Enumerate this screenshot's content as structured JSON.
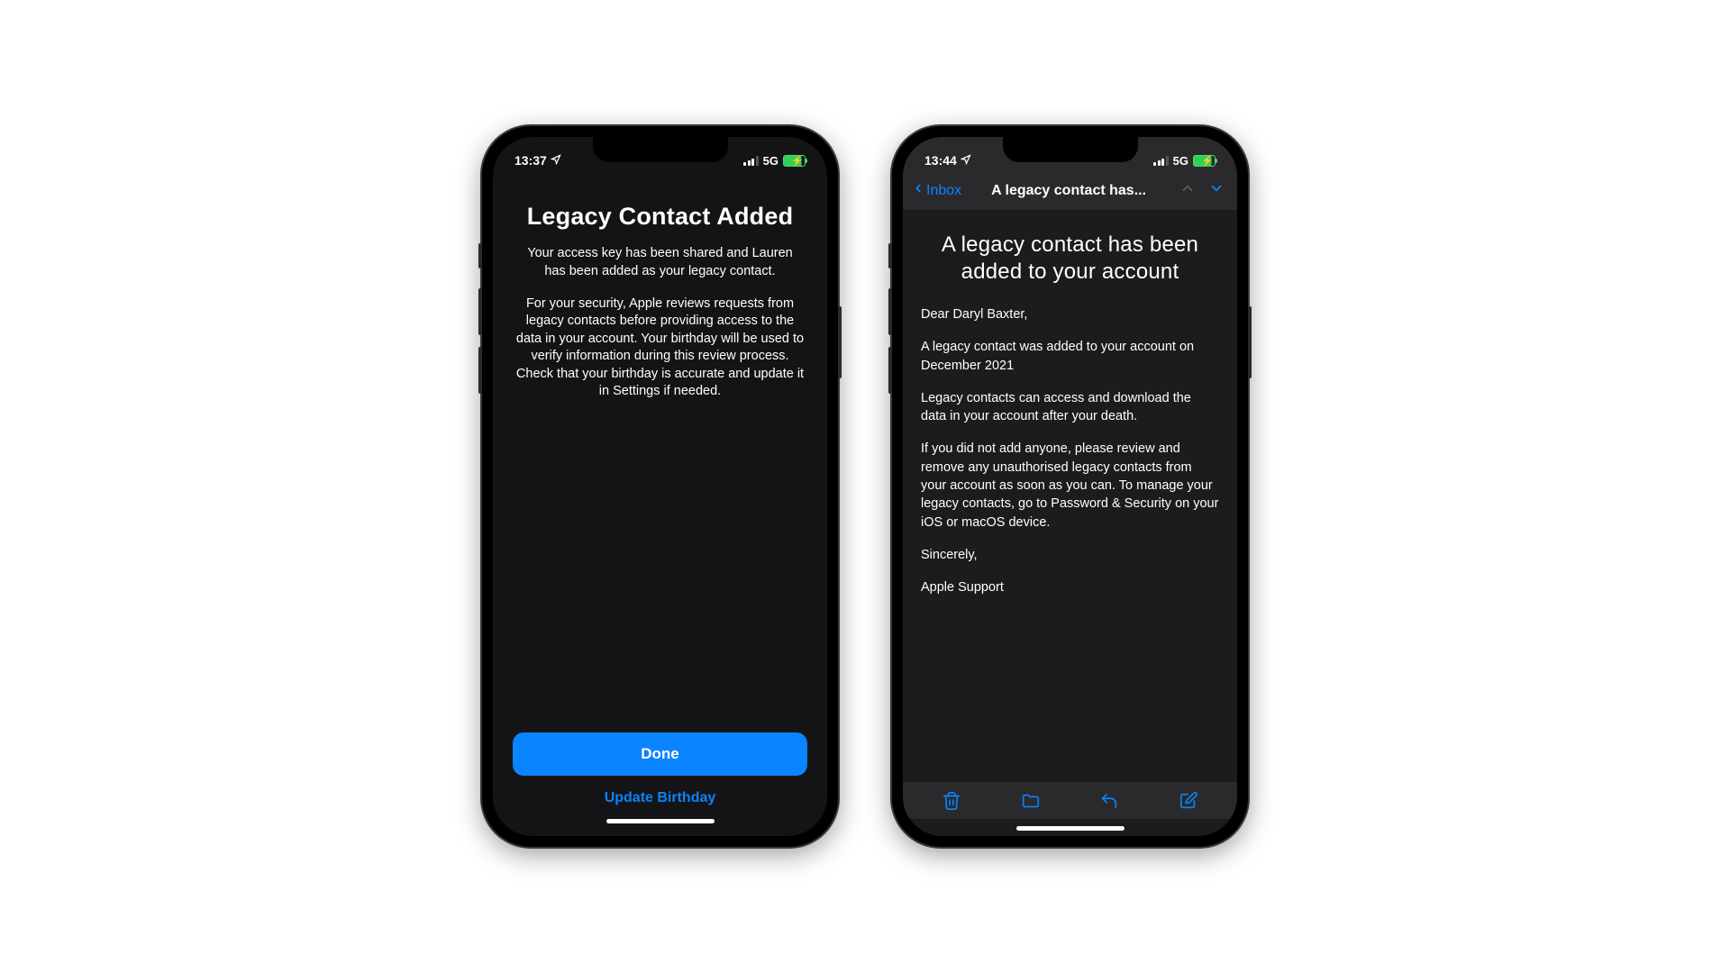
{
  "phone1": {
    "status": {
      "time": "13:37",
      "network": "5G"
    },
    "title": "Legacy Contact Added",
    "para1": "Your access key has been shared and Lauren                     has been added as your legacy contact.",
    "para2": "For your security, Apple reviews requests from legacy contacts before providing access to the data in your account. Your birthday will be used to verify information during this review process. Check that your birthday is accurate and update it in Settings if needed.",
    "primary_button": "Done",
    "secondary_button": "Update Birthday"
  },
  "phone2": {
    "status": {
      "time": "13:44",
      "network": "5G"
    },
    "nav": {
      "back_label": "Inbox",
      "title": "A legacy contact has..."
    },
    "mail": {
      "title": "A legacy contact has been added to your account",
      "greeting": "Dear Daryl Baxter,",
      "p1": "A legacy contact was added to your account on      December 2021",
      "p2": "Legacy contacts can access and download the data in your account after your death.",
      "p3": "If you did not add anyone, please review and remove any unauthorised legacy contacts from your account as soon as you can. To manage your legacy contacts, go to Password & Security on your iOS or macOS device.",
      "closing": "Sincerely,",
      "sender": "Apple Support"
    }
  }
}
